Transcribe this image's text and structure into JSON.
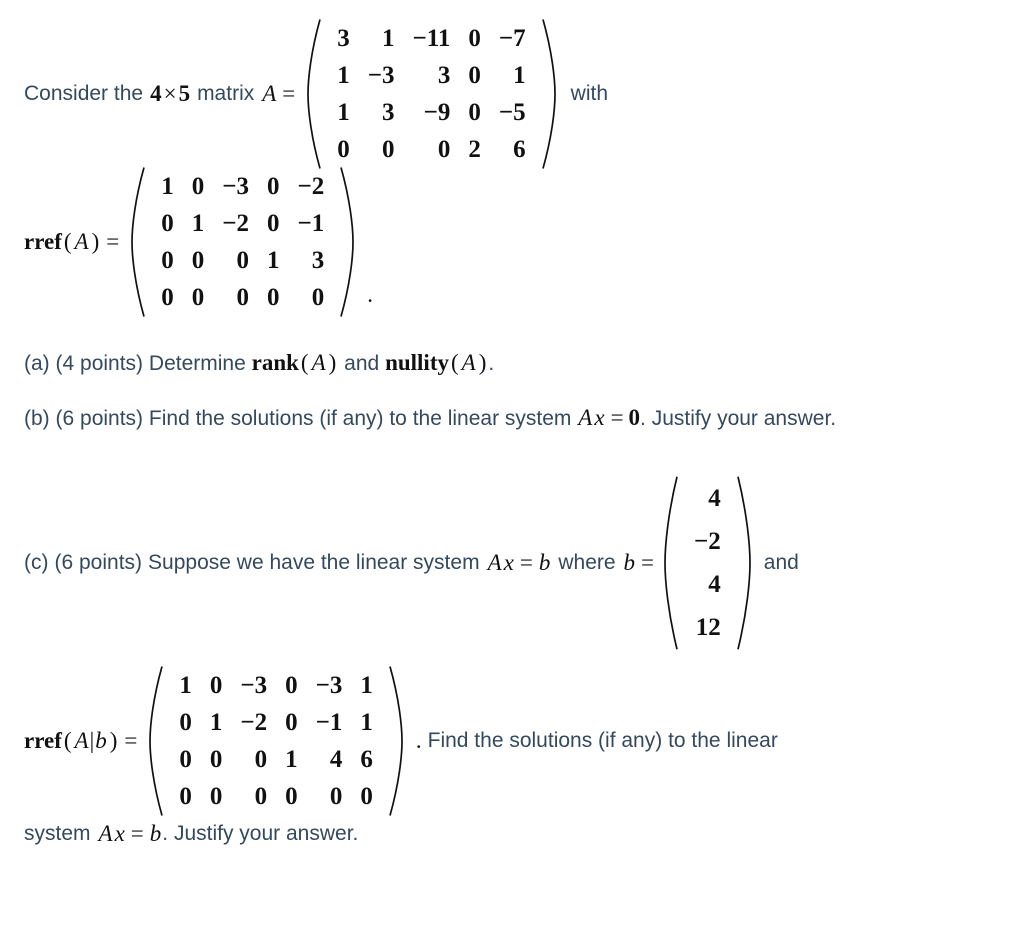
{
  "document": {
    "type": "linear-algebra-problem",
    "text_color": "#34495e",
    "math_color": "#111111",
    "background": "#ffffff"
  },
  "intro": {
    "before_dims": "Consider the",
    "dims_rows": "4",
    "dims_times": "×",
    "dims_cols": "5",
    "after_dims": "matrix",
    "matrix_name": "A",
    "equals": "=",
    "trailing": "with"
  },
  "matrix_A": {
    "label": "A",
    "rows": 4,
    "cols": 5,
    "values": [
      [
        "3",
        "1",
        "−11",
        "0",
        "−7"
      ],
      [
        "1",
        "−3",
        "3",
        "0",
        "1"
      ],
      [
        "1",
        "3",
        "−9",
        "0",
        "−5"
      ],
      [
        "0",
        "0",
        "0",
        "2",
        "6"
      ]
    ]
  },
  "rref_A": {
    "label_op": "rref",
    "label_open": "(",
    "label_arg": "A",
    "label_close": ")",
    "equals": "=",
    "rows": 4,
    "cols": 5,
    "values": [
      [
        "1",
        "0",
        "−3",
        "0",
        "−2"
      ],
      [
        "0",
        "1",
        "−2",
        "0",
        "−1"
      ],
      [
        "0",
        "0",
        "0",
        "1",
        "3"
      ],
      [
        "0",
        "0",
        "0",
        "0",
        "0"
      ]
    ],
    "terminator": "."
  },
  "parts": [
    {
      "id": "a",
      "marker": "(a)",
      "points": "(4 points)",
      "text_1": "Determine",
      "math_1_op": "rank",
      "math_1_open": "(",
      "math_1_arg": "A",
      "math_1_close": ")",
      "text_2": "and",
      "math_2_op": "nullity",
      "math_2_open": "(",
      "math_2_arg": "A",
      "math_2_close": ")",
      "text_3": "."
    },
    {
      "id": "b",
      "marker": "(b)",
      "points": "(6 points)",
      "text_1": "Find the solutions (if any) to the linear system",
      "math_A": "A",
      "math_x": "x",
      "math_eq": "=",
      "math_zero": "0",
      "text_2": ". Justify your answer."
    },
    {
      "id": "c",
      "marker": "(c)",
      "points": "(6 points)",
      "text_1": "Suppose we have the linear system",
      "math_A": "A",
      "math_x": "x",
      "math_eq": "=",
      "math_b": "b",
      "text_2": "where",
      "math_b2": "b",
      "math_eq2": "=",
      "text_3": "and"
    }
  ],
  "vector_b": {
    "name": "b",
    "rows": 4,
    "cols": 1,
    "values": [
      [
        "4"
      ],
      [
        "−2"
      ],
      [
        "4"
      ],
      [
        "12"
      ]
    ]
  },
  "rref_Ab": {
    "label_op": "rref",
    "label_open": "(",
    "label_arg": "A",
    "label_bar": "|",
    "label_arg2": "b",
    "label_close": ")",
    "equals": "=",
    "rows": 4,
    "cols": 6,
    "values": [
      [
        "1",
        "0",
        "−3",
        "0",
        "−3",
        "1"
      ],
      [
        "0",
        "1",
        "−2",
        "0",
        "−1",
        "1"
      ],
      [
        "0",
        "0",
        "0",
        "1",
        "4",
        "6"
      ],
      [
        "0",
        "0",
        "0",
        "0",
        "0",
        "0"
      ]
    ],
    "terminator": ".",
    "after_text": "Find the solutions (if any) to the linear",
    "final_text_1": "system",
    "final_math_A": "A",
    "final_math_x": "x",
    "final_math_eq": "=",
    "final_math_b": "b",
    "final_text_2": ". Justify your answer."
  }
}
